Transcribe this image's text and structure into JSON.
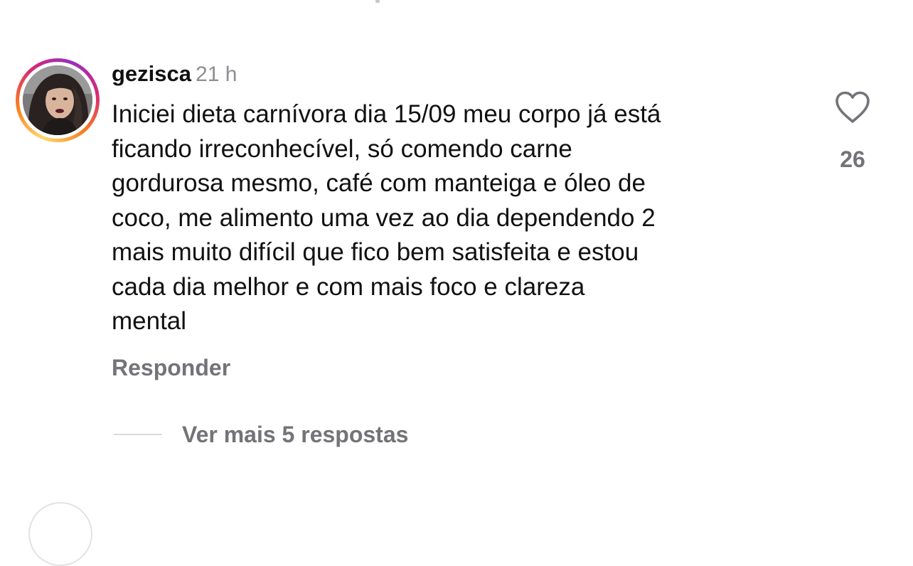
{
  "comment": {
    "username": "gezisca",
    "time": "21 h",
    "text": "Iniciei dieta carnívora dia 15/09 meu corpo já está\nficando irreconhecível, só comendo carne\ngordurosa mesmo, café com manteiga e óleo de\ncoco, me alimento uma vez ao dia dependendo 2\nmais muito difícil que fico bem satisfeita e estou\ncada dia melhor e com mais foco e clareza\nmental",
    "reply_label": "Responder",
    "like_icon": "heart-outline-icon",
    "like_count": "26",
    "view_replies_label": "Ver mais 5 respostas"
  },
  "colors": {
    "text": "#111111",
    "secondary": "#737378",
    "timestamp": "#8e8e93",
    "story_ring": [
      "#feda75",
      "#fa7e1e",
      "#d62976",
      "#962fbf"
    ]
  }
}
